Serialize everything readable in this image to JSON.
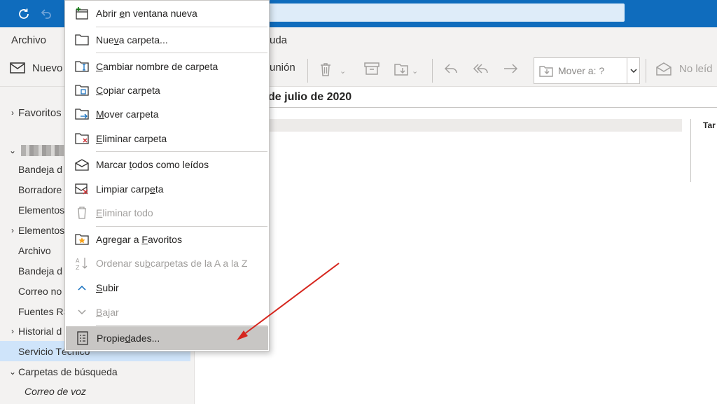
{
  "menubar": {
    "archivo": "Archivo",
    "ayuda_partial": "uda"
  },
  "ribbon": {
    "new_label": "Nuevo",
    "meeting_partial": "unión",
    "move_to_placeholder": "Mover a: ?",
    "unread_partial": "No leíd"
  },
  "folders": {
    "favoritos": "Favoritos",
    "items": [
      "Bandeja d",
      "Borradore",
      "Elementos",
      "Elementos",
      "Archivo",
      "Bandeja d",
      "Correo no",
      "Fuentes RS",
      "Historial d",
      "Servicio Técnico",
      "Carpetas de búsqueda",
      "Correo de voz"
    ]
  },
  "content": {
    "date_header": "de julio de 2020",
    "column_partial": "Tar"
  },
  "context_menu": {
    "items": [
      {
        "pre": "Abrir ",
        "key": "e",
        "post": "n ventana nueva",
        "disabled": false,
        "icon": "open-new-window-icon"
      },
      {
        "pre": "Nue",
        "key": "v",
        "post": "a carpeta...",
        "disabled": false,
        "icon": "new-folder-icon"
      },
      {
        "pre": "",
        "key": "C",
        "post": "ambiar nombre de carpeta",
        "disabled": false,
        "icon": "rename-folder-icon"
      },
      {
        "pre": "",
        "key": "C",
        "post": "opiar carpeta",
        "disabled": false,
        "icon": "copy-folder-icon"
      },
      {
        "pre": "",
        "key": "M",
        "post": "over carpeta",
        "disabled": false,
        "icon": "move-folder-icon"
      },
      {
        "pre": "",
        "key": "E",
        "post": "liminar carpeta",
        "disabled": false,
        "icon": "delete-folder-icon"
      },
      {
        "pre": "Marcar ",
        "key": "t",
        "post": "odos como leídos",
        "disabled": false,
        "icon": "mark-read-icon"
      },
      {
        "pre": "Limpiar carp",
        "key": "e",
        "post": "ta",
        "disabled": false,
        "icon": "clean-folder-icon"
      },
      {
        "pre": "",
        "key": "E",
        "post": "liminar todo",
        "disabled": true,
        "icon": "delete-all-icon"
      },
      {
        "pre": "Agregar a ",
        "key": "F",
        "post": "avoritos",
        "disabled": false,
        "icon": "add-favorites-icon"
      },
      {
        "pre": "Ordenar su",
        "key": "b",
        "post": "carpetas de la A a la Z",
        "disabled": true,
        "icon": "sort-az-icon"
      },
      {
        "pre": "",
        "key": "S",
        "post": "ubir",
        "disabled": false,
        "icon": "chevron-up-icon"
      },
      {
        "pre": "",
        "key": "B",
        "post": "ajar",
        "disabled": true,
        "icon": "chevron-down-icon"
      },
      {
        "pre": "Propie",
        "key": "d",
        "post": "ades...",
        "disabled": false,
        "icon": "properties-icon"
      }
    ]
  },
  "colors": {
    "titlebar": "#0f6cbd",
    "selected_folder": "#cfe4fa",
    "annotation_arrow": "#d6261e"
  }
}
